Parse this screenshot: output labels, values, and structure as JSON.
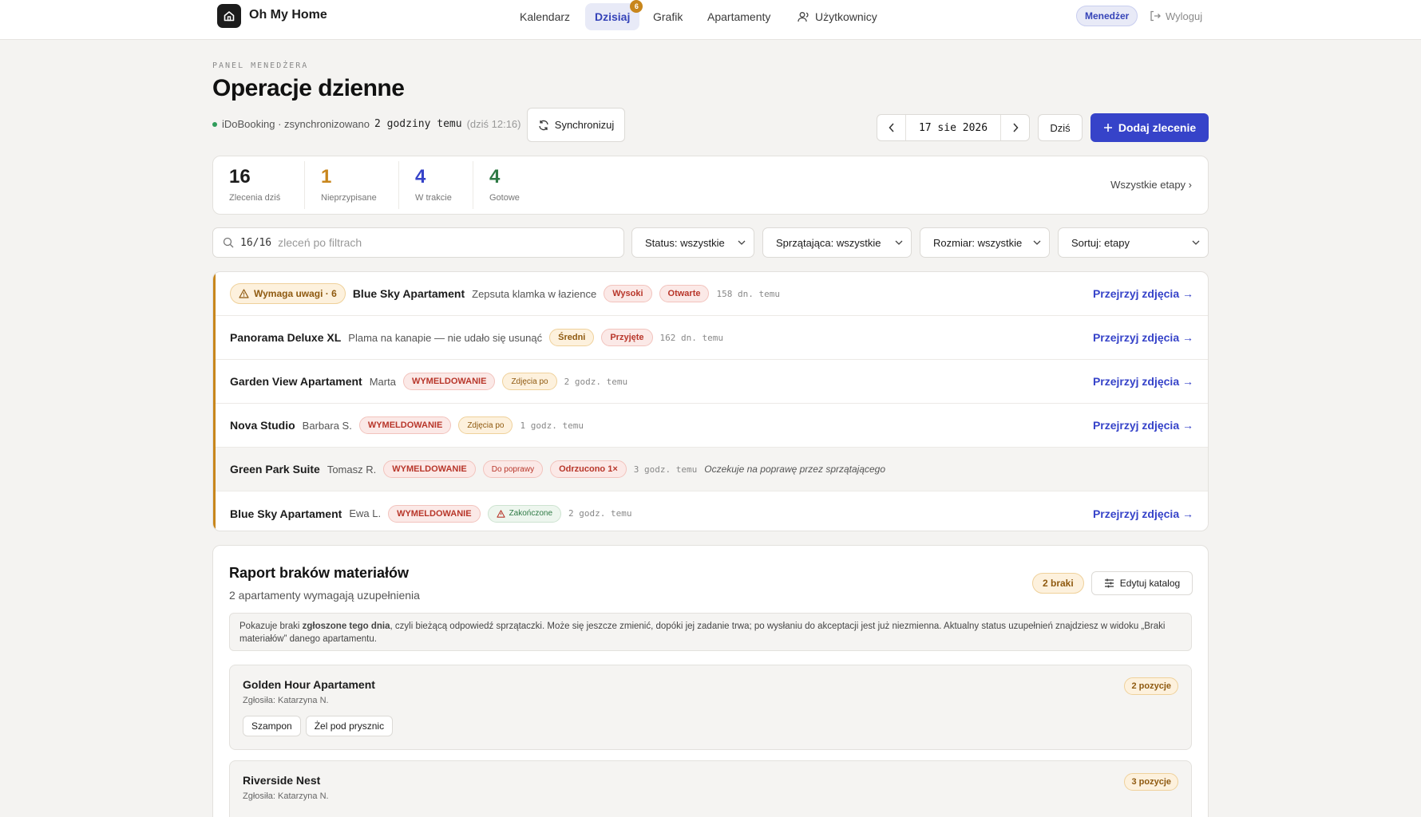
{
  "header": {
    "brand": "Oh My Home",
    "nav": [
      {
        "label": "Kalendarz"
      },
      {
        "label": "Dzisiaj",
        "badge": "6"
      },
      {
        "label": "Grafik"
      },
      {
        "label": "Apartamenty"
      },
      {
        "label": "Użytkownicy"
      }
    ],
    "role": "Menedżer",
    "logout": "Wyloguj"
  },
  "page": {
    "eyebrow": "PANEL MENEDŻERA",
    "title": "Operacje dzienne",
    "sync_source": "iDoBooking · zsynchronizowano",
    "sync_ago": "2 godziny temu",
    "sync_time": "(dziś 12:16)",
    "sync_button": "Synchronizuj",
    "date": "17 sie 2026",
    "today_button": "Dziś",
    "add_button": "Dodaj zlecenie"
  },
  "stats": [
    {
      "value": "16",
      "label": "Zlecenia dziś",
      "color": "#1c1c1c"
    },
    {
      "value": "1",
      "label": "Nieprzypisane",
      "color": "#c8861c"
    },
    {
      "value": "4",
      "label": "W trakcie",
      "color": "#3643c9"
    },
    {
      "value": "4",
      "label": "Gotowe",
      "color": "#2f7a45"
    }
  ],
  "stats_link": "Wszystkie etapy ›",
  "filters": {
    "search_count": "16/16",
    "search_placeholder": "zleceń po filtrach",
    "status": "Status: wszystkie",
    "cleaner": "Sprzątająca: wszystkie",
    "size": "Rozmiar: wszystkie",
    "sort": "Sortuj: etapy"
  },
  "tasks": [
    {
      "warn": "Wymaga uwagi · 6",
      "name": "Blue Sky Apartament",
      "sub": "Zepsuta klamka w łazience",
      "p1": "Wysoki",
      "p2": "Otwarte",
      "ago": "158 dn. temu",
      "link": "Przejrzyj zdjęcia →"
    },
    {
      "name": "Panorama Deluxe XL",
      "sub": "Plama na kanapie — nie udało się usunąć",
      "p1": "Średni",
      "p2": "Przyjęte",
      "ago": "162 dn. temu",
      "link": "Przejrzyj zdjęcia →"
    },
    {
      "name": "Garden View Apartament",
      "sub": "Marta",
      "p1": "WYMELDOWANIE",
      "p2": "Zdjęcia po",
      "ago": "2 godz. temu",
      "link": "Przejrzyj zdjęcia →"
    },
    {
      "name": "Nova Studio",
      "sub": "Barbara S.",
      "p1": "WYMELDOWANIE",
      "p2": "Zdjęcia po",
      "ago": "1 godz. temu",
      "link": "Przejrzyj zdjęcia →"
    },
    {
      "name": "Green Park Suite",
      "sub": "Tomasz R.",
      "p1": "WYMELDOWANIE",
      "p2": "Do poprawy",
      "p3": "Odrzucono 1×",
      "ago": "3 godz. temu",
      "note": "Oczekuje na poprawę przez sprzątającego"
    },
    {
      "name": "Blue Sky Apartament",
      "sub": "Ewa L.",
      "p1": "WYMELDOWANIE",
      "p2": "Zakończone",
      "ago": "2 godz. temu",
      "link": "Przejrzyj zdjęcia →"
    }
  ],
  "report": {
    "title": "Raport braków materiałów",
    "subtitle": "2 apartamenty wymagają uzupełnienia",
    "badge": "2 braki",
    "edit_button": "Edytuj katalog",
    "info_a": "Pokazuje braki ",
    "info_b": "zgłoszone tego dnia",
    "info_c": ", czyli bieżącą odpowiedź sprzątaczki. Może się jeszcze zmienić, dopóki jej zadanie trwa; po wysłaniu do akceptacji jest już niezmienna. Aktualny status uzupełnień znajdziesz w widoku „Braki materiałów” danego apartamentu.",
    "apartments": [
      {
        "name": "Golden Hour Apartament",
        "reporter": "Zgłosiła: Katarzyna N.",
        "count": "2 pozycje",
        "items": [
          "Szampon",
          "Żel pod prysznic"
        ]
      },
      {
        "name": "Riverside Nest",
        "reporter": "Zgłosiła: Katarzyna N.",
        "count": "3 pozycje"
      }
    ]
  }
}
